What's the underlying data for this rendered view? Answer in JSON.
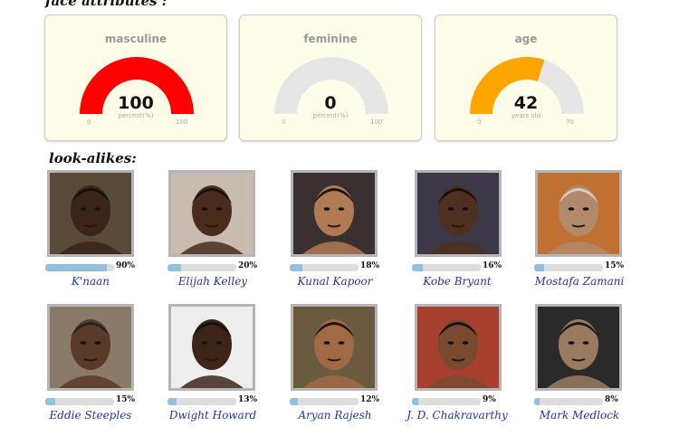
{
  "headings": {
    "face_attributes": "face attributes :",
    "look_alikes": "look-alikes:"
  },
  "gauges": [
    {
      "title": "masculine",
      "value": 100,
      "value_text": "100",
      "unit": "percent(%)",
      "min": 0,
      "max": 100,
      "min_text": "0",
      "max_text": "100",
      "color": "#ff0000"
    },
    {
      "title": "feminine",
      "value": 0,
      "value_text": "0",
      "unit": "percent(%)",
      "min": 0,
      "max": 100,
      "min_text": "0",
      "max_text": "100",
      "color": "#ff0000"
    },
    {
      "title": "age",
      "value": 42,
      "value_text": "42",
      "unit": "years old",
      "min": 0,
      "max": 70,
      "min_text": "0",
      "max_text": "70",
      "color": "#ffa500"
    }
  ],
  "colors": {
    "gauge_track": "#e6e6e6",
    "bar_fill": "#93c0dd",
    "bar_track": "#dddddd",
    "name_link": "#2433a8"
  },
  "lookalikes": [
    {
      "name": "K'naan",
      "similarity": 0.9,
      "pct_text": "90%"
    },
    {
      "name": "Elijah Kelley",
      "similarity": 0.2,
      "pct_text": "20%"
    },
    {
      "name": "Kunal Kapoor",
      "similarity": 0.18,
      "pct_text": "18%"
    },
    {
      "name": "Kobe Bryant",
      "similarity": 0.16,
      "pct_text": "16%"
    },
    {
      "name": "Mostafa Zamani",
      "similarity": 0.15,
      "pct_text": "15%"
    },
    {
      "name": "Eddie Steeples",
      "similarity": 0.15,
      "pct_text": "15%"
    },
    {
      "name": "Dwight Howard",
      "similarity": 0.13,
      "pct_text": "13%"
    },
    {
      "name": "Aryan Rajesh",
      "similarity": 0.12,
      "pct_text": "12%"
    },
    {
      "name": "J. D. Chakravarthy",
      "similarity": 0.09,
      "pct_text": "9%"
    },
    {
      "name": "Mark Medlock",
      "similarity": 0.08,
      "pct_text": "8%"
    }
  ]
}
